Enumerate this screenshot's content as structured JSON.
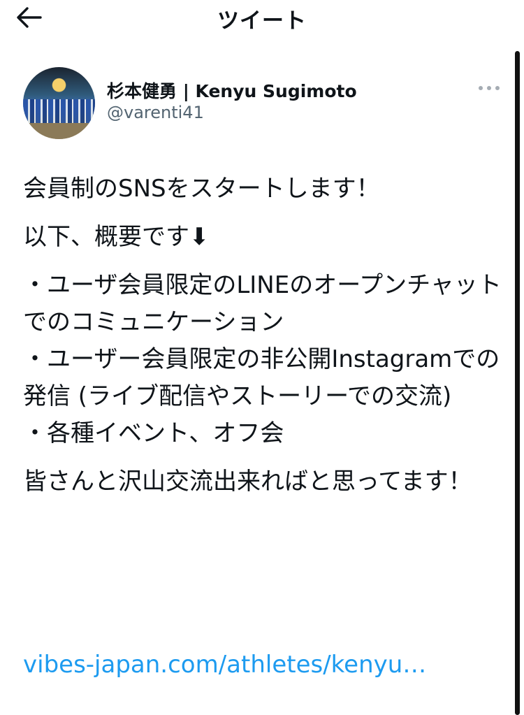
{
  "header": {
    "title": "ツイート",
    "back_icon": "arrow-left-icon"
  },
  "author": {
    "display_name": "杉本健勇 | Kenyu Sugimoto",
    "handle": "@varenti41",
    "more_icon": "more-horizontal-icon"
  },
  "tweet": {
    "paragraphs": [
      "会員制のSNSをスタートします！",
      "以下、概要です⬇",
      "・ユーザ会員限定のLINEのオープンチャットでのコミュニケーション\n・ユーザー会員限定の非公開Instagramでの発信 (ライブ配信やストーリーでの交流)\n・各種イベント、オフ会",
      "皆さんと沢山交流出来ればと思ってます！"
    ],
    "link_text": "vibes-japan.com/athletes/kenyu…"
  },
  "colors": {
    "text": "#0f1419",
    "secondary": "#536471",
    "link": "#1d9bf0"
  }
}
